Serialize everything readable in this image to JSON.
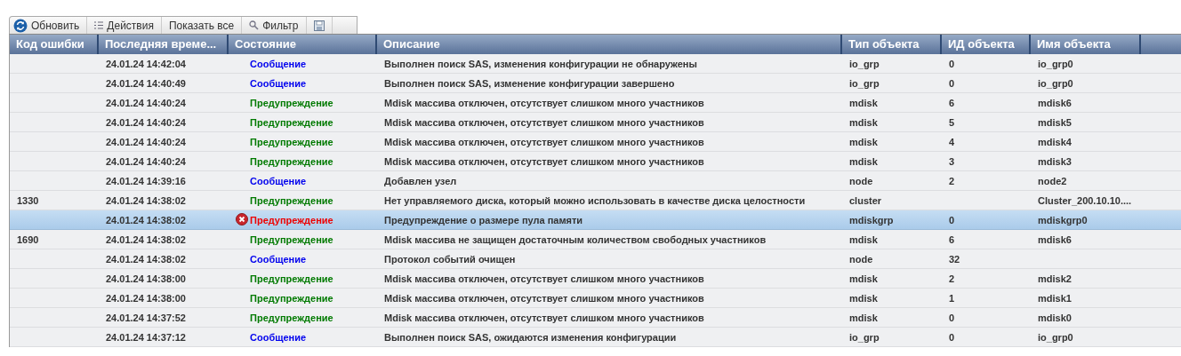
{
  "toolbar": [
    {
      "kind": "refresh",
      "label": "Обновить"
    },
    {
      "kind": "actions",
      "label": "Действия"
    },
    {
      "kind": "plain",
      "label": "Показать все"
    },
    {
      "kind": "filter",
      "label": "Фильтр"
    },
    {
      "kind": "save"
    }
  ],
  "table": {
    "columns": [
      "Код ошибки",
      "Последняя време...",
      "Состояние",
      "Описание",
      "Тип объекта",
      "ИД объекта",
      "Имя объекта"
    ],
    "rows": [
      {
        "code": "",
        "time": "24.01.24 14:42:04",
        "status": "Сообщение",
        "kind": "message",
        "description": "Выполнен поиск SAS, изменения конфигурации не обнаружены",
        "type": "io_grp",
        "id": "0",
        "name": "io_grp0",
        "selected": false
      },
      {
        "code": "",
        "time": "24.01.24 14:40:49",
        "status": "Сообщение",
        "kind": "message",
        "description": "Выполнен поиск SAS, изменение конфигурации завершено",
        "type": "io_grp",
        "id": "0",
        "name": "io_grp0",
        "selected": false
      },
      {
        "code": "",
        "time": "24.01.24 14:40:24",
        "status": "Предупреждение",
        "kind": "warning",
        "description": "Mdisk массива отключен, отсутствует слишком много участников",
        "type": "mdisk",
        "id": "6",
        "name": "mdisk6",
        "selected": false
      },
      {
        "code": "",
        "time": "24.01.24 14:40:24",
        "status": "Предупреждение",
        "kind": "warning",
        "description": "Mdisk массива отключен, отсутствует слишком много участников",
        "type": "mdisk",
        "id": "5",
        "name": "mdisk5",
        "selected": false
      },
      {
        "code": "",
        "time": "24.01.24 14:40:24",
        "status": "Предупреждение",
        "kind": "warning",
        "description": "Mdisk массива отключен, отсутствует слишком много участников",
        "type": "mdisk",
        "id": "4",
        "name": "mdisk4",
        "selected": false
      },
      {
        "code": "",
        "time": "24.01.24 14:40:24",
        "status": "Предупреждение",
        "kind": "warning",
        "description": "Mdisk массива отключен, отсутствует слишком много участников",
        "type": "mdisk",
        "id": "3",
        "name": "mdisk3",
        "selected": false
      },
      {
        "code": "",
        "time": "24.01.24 14:39:16",
        "status": "Сообщение",
        "kind": "message",
        "description": "Добавлен узел",
        "type": "node",
        "id": "2",
        "name": "node2",
        "selected": false
      },
      {
        "code": "1330",
        "time": "24.01.24 14:38:02",
        "status": "Предупреждение",
        "kind": "warning",
        "description": "Нет управляемого диска, который можно использовать в качестве диска целостности",
        "type": "cluster",
        "id": "",
        "name": "Cluster_200.10.10....",
        "selected": false
      },
      {
        "code": "",
        "time": "24.01.24 14:38:02",
        "status": "Предупреждение",
        "kind": "error",
        "description": "Предупреждение о размере пула памяти",
        "type": "mdiskgrp",
        "id": "0",
        "name": "mdiskgrp0",
        "selected": true
      },
      {
        "code": "1690",
        "time": "24.01.24 14:38:02",
        "status": "Предупреждение",
        "kind": "warning",
        "description": "Mdisk массива не защищен достаточным количеством свободных участников",
        "type": "mdisk",
        "id": "6",
        "name": "mdisk6",
        "selected": false
      },
      {
        "code": "",
        "time": "24.01.24 14:38:02",
        "status": "Сообщение",
        "kind": "message",
        "description": "Протокол событий очищен",
        "type": "node",
        "id": "32",
        "name": "",
        "selected": false
      },
      {
        "code": "",
        "time": "24.01.24 14:38:00",
        "status": "Предупреждение",
        "kind": "warning",
        "description": "Mdisk массива отключен, отсутствует слишком много участников",
        "type": "mdisk",
        "id": "2",
        "name": "mdisk2",
        "selected": false
      },
      {
        "code": "",
        "time": "24.01.24 14:38:00",
        "status": "Предупреждение",
        "kind": "warning",
        "description": "Mdisk массива отключен, отсутствует слишком много участников",
        "type": "mdisk",
        "id": "1",
        "name": "mdisk1",
        "selected": false
      },
      {
        "code": "",
        "time": "24.01.24 14:37:52",
        "status": "Предупреждение",
        "kind": "warning",
        "description": "Mdisk массива отключен, отсутствует слишком много участников",
        "type": "mdisk",
        "id": "0",
        "name": "mdisk0",
        "selected": false
      },
      {
        "code": "",
        "time": "24.01.24 14:37:12",
        "status": "Сообщение",
        "kind": "message",
        "description": "Выполнен поиск SAS, ожидаются изменения конфигурации",
        "type": "io_grp",
        "id": "0",
        "name": "io_grp0",
        "selected": false
      }
    ]
  }
}
